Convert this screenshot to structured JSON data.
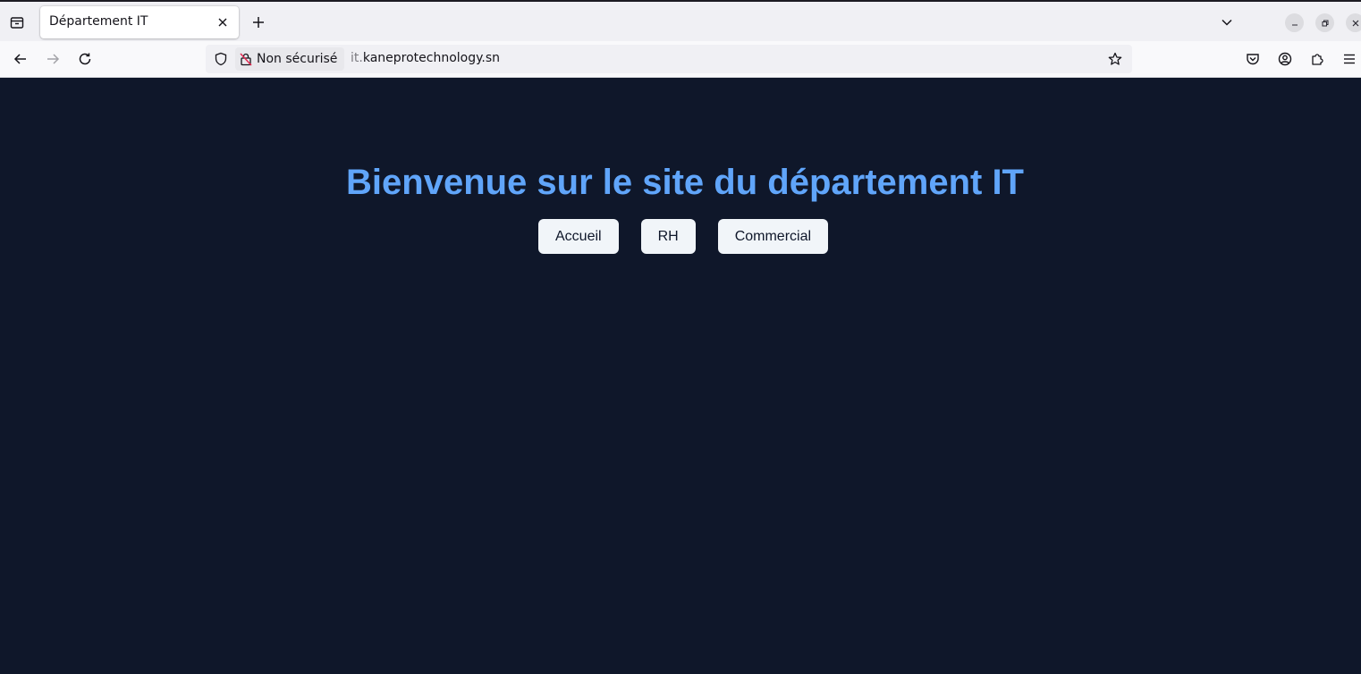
{
  "browser": {
    "tab": {
      "title": "Département IT",
      "close_icon": "close-icon"
    },
    "new_tab_icon": "plus-icon",
    "tab_overflow_icon": "chevron-down-icon",
    "window_controls": [
      "minimize-icon",
      "restore-icon",
      "close-icon"
    ],
    "nav": {
      "back_icon": "arrow-left-icon",
      "forward_icon": "arrow-right-icon",
      "reload_icon": "reload-icon"
    },
    "urlbar": {
      "security_label": "Non sécurisé",
      "url_subdomain": "it.",
      "url_domain": "kaneprotechnology.sn"
    },
    "toolbar_icons": [
      "pocket-icon",
      "account-icon",
      "extensions-icon",
      "menu-icon"
    ]
  },
  "page": {
    "title": "Bienvenue sur le site du département IT",
    "nav_buttons": [
      {
        "label": "Accueil"
      },
      {
        "label": "RH"
      },
      {
        "label": "Commercial"
      }
    ]
  },
  "colors": {
    "page_background": "#0f172a",
    "title": "#60a5fa",
    "button_background": "#f1f5f9",
    "button_text": "#0f172a"
  }
}
